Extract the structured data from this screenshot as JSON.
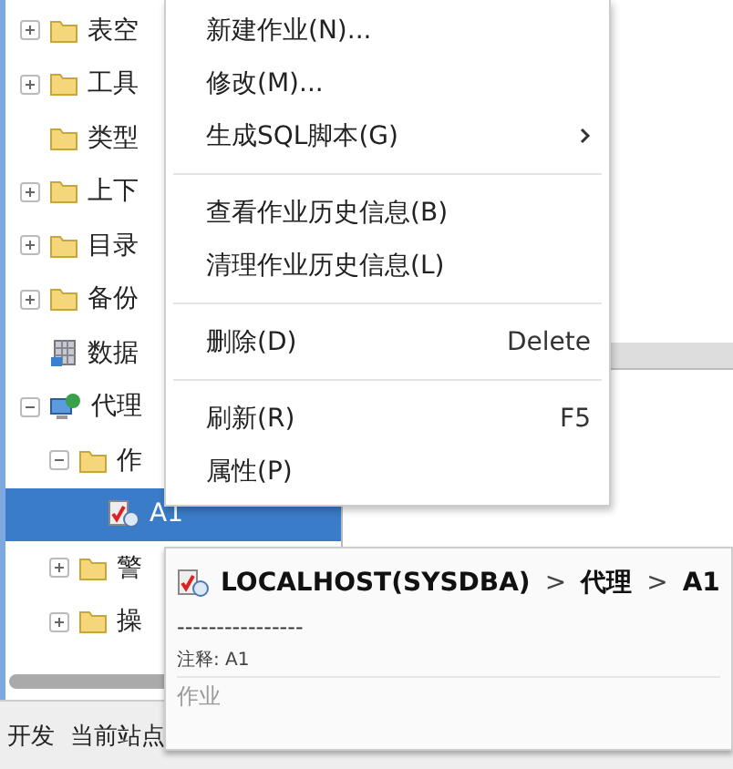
{
  "tree": [
    {
      "label": "表空",
      "kind": "folder",
      "expanded": false,
      "selected": false
    },
    {
      "label": "工具",
      "kind": "folder",
      "expanded": false,
      "selected": false
    },
    {
      "label": "类型",
      "kind": "folder",
      "selected": false
    },
    {
      "label": "上下",
      "kind": "folder",
      "expanded": false,
      "selected": false
    },
    {
      "label": "目录",
      "kind": "folder",
      "expanded": false,
      "selected": false
    },
    {
      "label": "备份",
      "kind": "folder",
      "expanded": false,
      "selected": false
    },
    {
      "label": "数据",
      "kind": "database",
      "selected": false
    },
    {
      "label": "代理",
      "kind": "agent",
      "expanded": true,
      "selected": false,
      "children": [
        {
          "label": "作",
          "kind": "folder",
          "expanded": true,
          "selected": false,
          "children": [
            {
              "label": "A1",
              "kind": "job",
              "selected": true
            }
          ]
        },
        {
          "label": "警",
          "kind": "folder",
          "expanded": false,
          "selected": false
        },
        {
          "label": "操",
          "kind": "folder",
          "expanded": false,
          "selected": false
        }
      ]
    }
  ],
  "status_bar": {
    "text": "开发  当前站点"
  },
  "context_menu": [
    [
      {
        "label": "新建作业(N)..."
      },
      {
        "label": "修改(M)..."
      },
      {
        "label": "生成SQL脚本(G)",
        "submenu": true
      }
    ],
    [
      {
        "label": "查看作业历史信息(B)"
      },
      {
        "label": "清理作业历史信息(L)"
      }
    ],
    [
      {
        "label": "删除(D)",
        "shortcut": "Delete"
      }
    ],
    [
      {
        "label": "刷新(R)",
        "shortcut": "F5"
      },
      {
        "label": "属性(P)"
      }
    ]
  ],
  "tooltip": {
    "path": [
      {
        "text": "LOCALHOST(SYSDBA)"
      },
      {
        "text": "代理"
      },
      {
        "text": "A1"
      }
    ],
    "separator": ">",
    "rule": "----------------",
    "comment": "注释: A1",
    "footer": "作业"
  }
}
